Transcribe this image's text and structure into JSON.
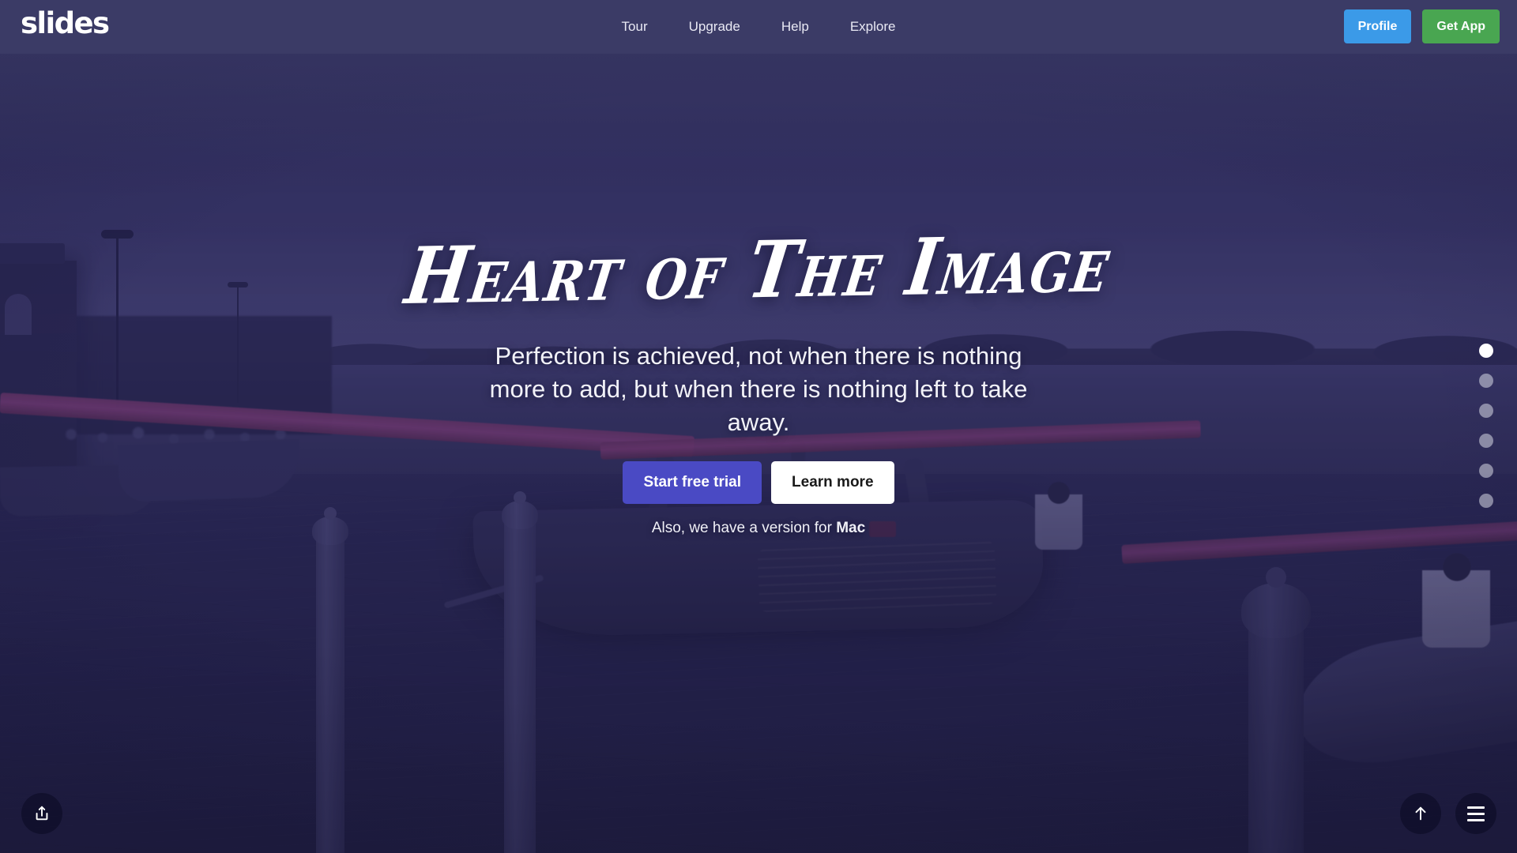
{
  "header": {
    "logo": "slides",
    "nav": [
      {
        "label": "Tour",
        "name": "nav-item-tour"
      },
      {
        "label": "Upgrade",
        "name": "nav-item-upgrade"
      },
      {
        "label": "Help",
        "name": "nav-item-help"
      },
      {
        "label": "Explore",
        "name": "nav-item-explore"
      }
    ],
    "profile_label": "Profile",
    "getapp_label": "Get App",
    "profile_color": "#3b9ae8",
    "getapp_color": "#49a651",
    "background_color": "#3b3b66"
  },
  "hero": {
    "headline": "Heart of The Image",
    "subhead": "Perfection is achieved, not when there is nothing more to add, but when there is nothing left to take away.",
    "cta_primary": "Start free trial",
    "cta_secondary": "Learn more",
    "cta_primary_color": "#4a4ac4",
    "footnote_prefix": "Also, we have a version for ",
    "footnote_platform": "Mac"
  },
  "pagination": {
    "total": 6,
    "active_index": 0,
    "active_color": "#ffffff",
    "inactive_color": "rgba(225,226,236,0.52)"
  },
  "controls": {
    "share": "share-icon",
    "scroll_up": "arrow-up-icon",
    "menu": "hamburger-menu-icon"
  },
  "background": {
    "description": "Dusk river scene with wooden boats, mooring posts and people, violet color grade",
    "tint_color": "#4840 8c"
  }
}
